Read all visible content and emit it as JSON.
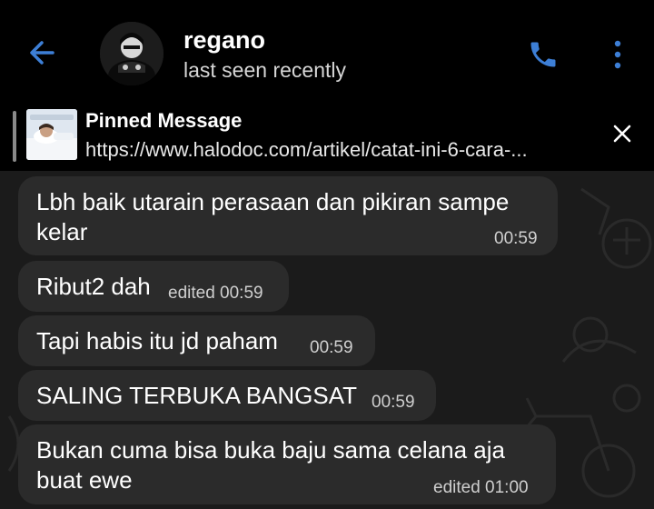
{
  "header": {
    "contact_name": "regano",
    "status": "last seen recently",
    "back_icon": "arrow-left-icon",
    "call_icon": "phone-icon",
    "more_icon": "more-vertical-icon",
    "accent_color": "#3d7fd6"
  },
  "pinned": {
    "title": "Pinned Message",
    "text": "https://www.halodoc.com/artikel/catat-ini-6-cara-..."
  },
  "messages": [
    {
      "line1": "Lbh baik utarain perasaan dan pikiran sampe",
      "line2": "kelar",
      "time": "00:59"
    },
    {
      "text": "Ribut2 dah",
      "time": "edited 00:59"
    },
    {
      "text": "Tapi habis itu jd paham",
      "time": "00:59"
    },
    {
      "text": "SALING TERBUKA BANGSAT",
      "time": "00:59"
    },
    {
      "line1": "Bukan cuma bisa buka baju sama celana aja",
      "line2": "buat ewe",
      "time": "edited 01:00"
    }
  ]
}
